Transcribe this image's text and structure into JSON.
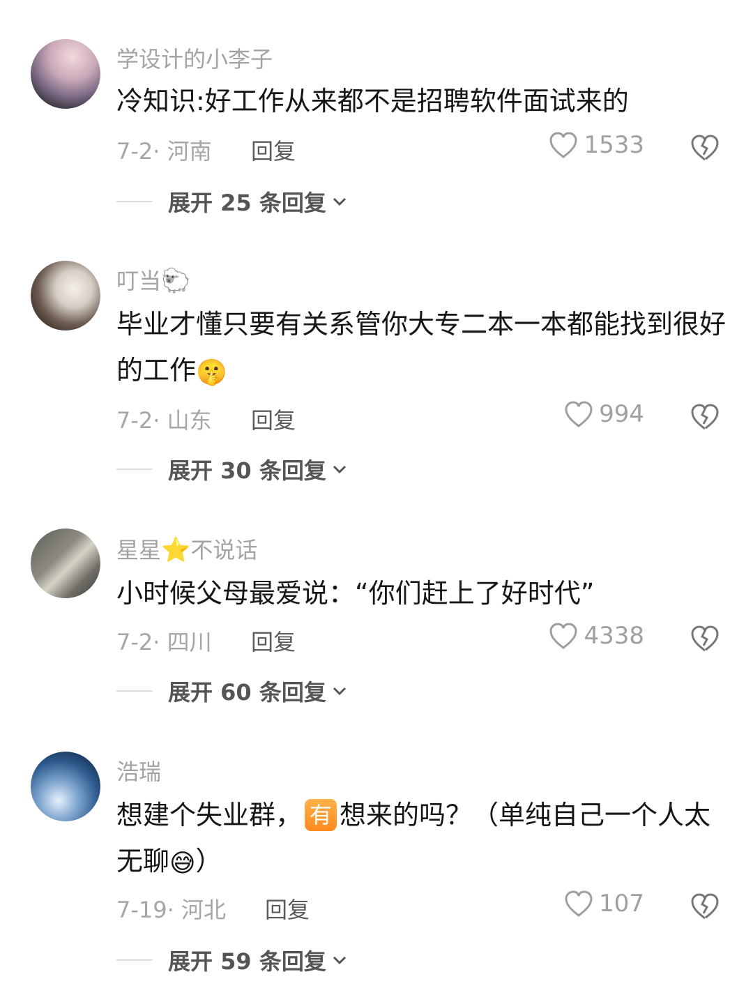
{
  "comments": [
    {
      "username": "学设计的小李子",
      "username_emoji": "",
      "text": "冷知识:好工作从来都不是招聘软件面试来的",
      "meta": "7-2· 河南",
      "reply_label": "回复",
      "likes": "1533",
      "expand_label": "展开 25 条回复"
    },
    {
      "username": "叮当",
      "username_emoji": "🐑",
      "text": "毕业才懂只要有关系管你大专二本一本都能找到很好的工作",
      "text_emoji": "🤫",
      "meta": "7-2· 山东",
      "reply_label": "回复",
      "likes": "994",
      "expand_label": "展开 30 条回复"
    },
    {
      "username_a": "星星",
      "username_emoji": "⭐",
      "username_b": "不说话",
      "text": "小时候父母最爱说：“你们赶上了好时代”",
      "meta": "7-2· 四川",
      "reply_label": "回复",
      "likes": "4338",
      "expand_label": "展开 60 条回复"
    },
    {
      "username": "浩瑞",
      "text_a": "想建个失业群，",
      "badge": "有",
      "text_b": "想来的吗？（单纯自己一个人太无聊",
      "text_emoji": "😅",
      "text_c": "）",
      "meta": "7-19· 河北",
      "reply_label": "回复",
      "likes": "107",
      "expand_label": "展开 59 条回复"
    }
  ],
  "icons": {
    "like": "heart-outline-icon",
    "dislike": "broken-heart-icon",
    "expand": "chevron-down-icon"
  },
  "colors": {
    "meta": "#a6a6a6",
    "text": "#161616",
    "badge": "#ff9a2e"
  }
}
